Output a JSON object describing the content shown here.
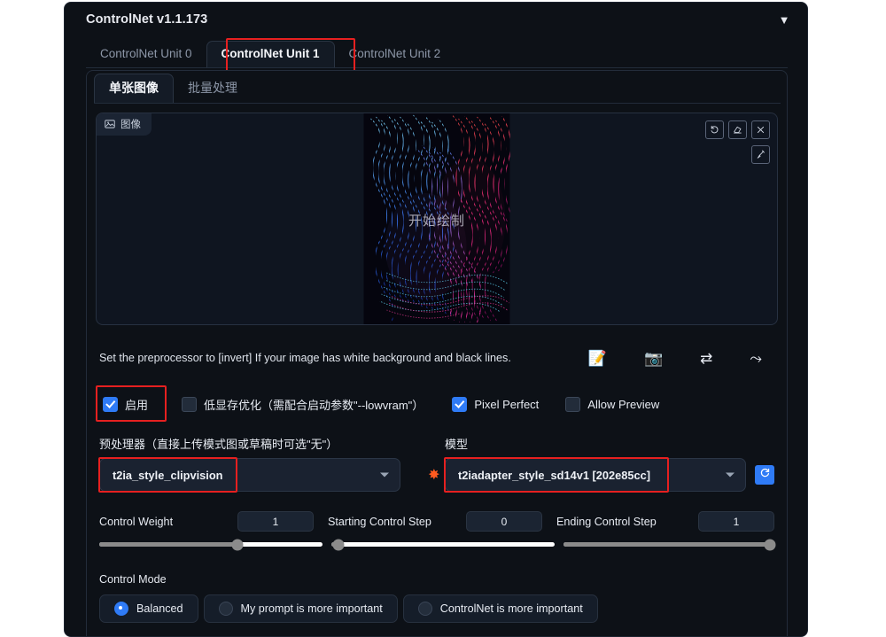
{
  "panel": {
    "title": "ControlNet v1.1.173",
    "collapse_icon": "chevron-down-icon"
  },
  "unit_tabs": [
    {
      "label": "ControlNet Unit 0",
      "active": false
    },
    {
      "label": "ControlNet Unit 1",
      "active": true
    },
    {
      "label": "ControlNet Unit 2",
      "active": false
    }
  ],
  "sub_tabs": [
    {
      "label": "单张图像",
      "active": true
    },
    {
      "label": "批量处理",
      "active": false
    }
  ],
  "image_area": {
    "badge_label": "图像",
    "badge_icon": "image-icon",
    "overlay_text": "开始绘制",
    "tools": [
      {
        "name": "undo-icon",
        "title": "撤销"
      },
      {
        "name": "eraser-icon",
        "title": "清除"
      },
      {
        "name": "close-icon",
        "title": "移除"
      }
    ],
    "tool_secondary": {
      "name": "brush-icon",
      "title": "画笔"
    }
  },
  "hint": {
    "text": "Set the preprocessor to [invert] If your image has white background and black lines.",
    "icons": [
      {
        "name": "edit-document-icon",
        "glyph": "📝"
      },
      {
        "name": "camera-icon",
        "glyph": "📷"
      },
      {
        "name": "swap-arrows-icon",
        "glyph": "⇄"
      },
      {
        "name": "send-arrow-icon",
        "glyph": "⤳"
      }
    ]
  },
  "checkboxes": [
    {
      "label": "启用",
      "checked": true,
      "highlighted": true
    },
    {
      "label": "低显存优化（需配合启动参数\"--lowvram\"）",
      "checked": false,
      "highlighted": false
    },
    {
      "label": "Pixel Perfect",
      "checked": true,
      "highlighted": false
    },
    {
      "label": "Allow Preview",
      "checked": false,
      "highlighted": false
    }
  ],
  "preprocessor": {
    "label": "预处理器（直接上传模式图或草稿时可选\"无\"）",
    "value": "t2ia_style_clipvision",
    "highlighted": true,
    "run_icon": "sparkle-icon"
  },
  "model": {
    "label": "模型",
    "value": "t2iadapter_style_sd14v1 [202e85cc]",
    "highlighted": true,
    "refresh_icon": "refresh-icon"
  },
  "sliders": [
    {
      "label": "Control Weight",
      "value": "1",
      "percent": 62
    },
    {
      "label": "Starting Control Step",
      "value": "0",
      "percent": 3
    },
    {
      "label": "Ending Control Step",
      "value": "1",
      "percent": 98
    }
  ],
  "control_mode": {
    "label": "Control Mode",
    "options": [
      {
        "label": "Balanced",
        "selected": true
      },
      {
        "label": "My prompt is more important",
        "selected": false
      },
      {
        "label": "ControlNet is more important",
        "selected": false
      }
    ]
  },
  "colors": {
    "background": "#0d1117",
    "accent": "#2f7bf6",
    "highlight": "#e62020",
    "text": "#e7ebf2",
    "muted": "#8d97a8"
  }
}
